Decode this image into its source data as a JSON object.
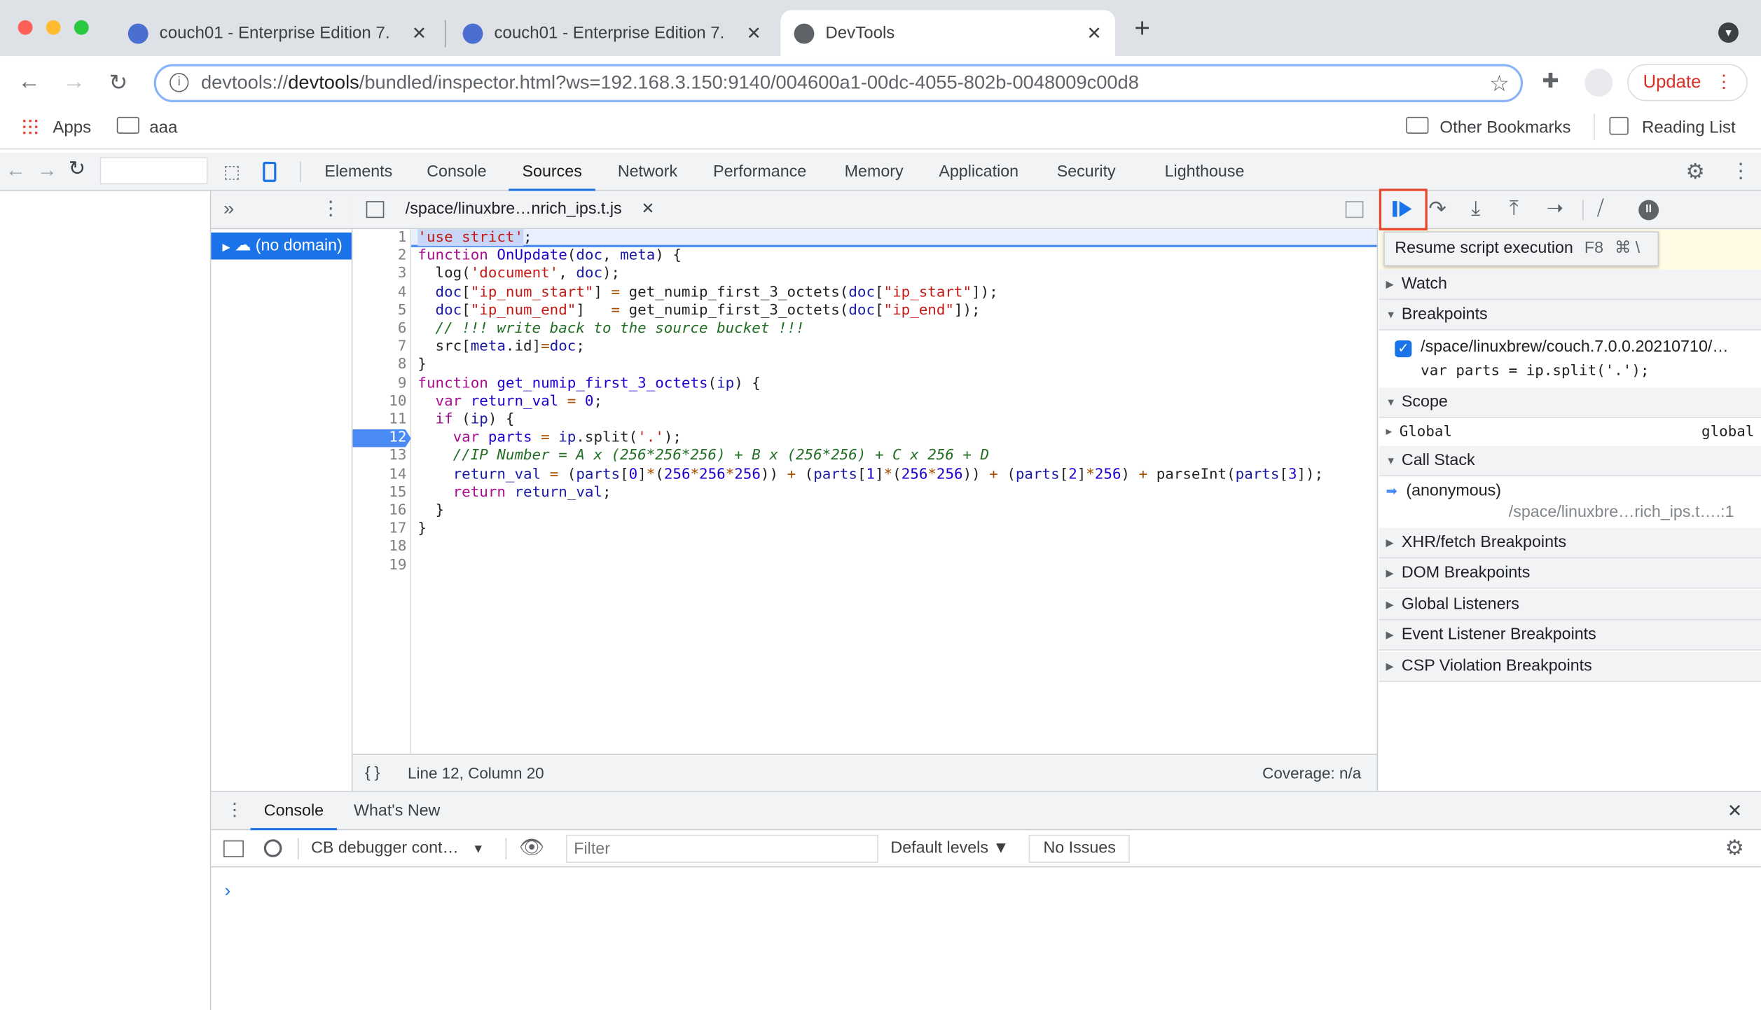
{
  "browser": {
    "tabs": [
      {
        "title": "couch01 - Enterprise Edition 7."
      },
      {
        "title": "couch01 - Enterprise Edition 7."
      },
      {
        "title": "DevTools"
      }
    ],
    "new_tab": "+",
    "url_prefix": "devtools://",
    "url_host": "devtools",
    "url_rest": "/bundled/inspector.html?ws=192.168.3.150:9140/004600a1-00dc-4055-802b-0048009c00d8",
    "update_label": "Update",
    "bookmarks": {
      "apps": "Apps",
      "folder": "aaa",
      "other": "Other Bookmarks",
      "reading_list": "Reading List"
    }
  },
  "devtools": {
    "tabs": [
      "Elements",
      "Console",
      "Sources",
      "Network",
      "Performance",
      "Memory",
      "Application",
      "Security",
      "Lighthouse"
    ],
    "active_tab": "Sources",
    "navigator": {
      "more": "»",
      "item": "(no domain)"
    },
    "file_tab": "/space/linuxbre…nrich_ips.t.js",
    "code": [
      [
        [
          "'use strict'",
          "str"
        ],
        [
          ";",
          "p"
        ]
      ],
      [
        [
          "function ",
          "kw"
        ],
        [
          "OnUpdate",
          "def"
        ],
        [
          "(",
          "p"
        ],
        [
          "doc",
          "var"
        ],
        [
          ", ",
          "p"
        ],
        [
          "meta",
          "var"
        ],
        [
          ") {",
          "p"
        ]
      ],
      [
        [
          "  log(",
          "p"
        ],
        [
          "'document'",
          "str"
        ],
        [
          ", ",
          "p"
        ],
        [
          "doc",
          "var"
        ],
        [
          ");",
          "p"
        ]
      ],
      [
        [
          "  ",
          "p"
        ],
        [
          "doc",
          "var"
        ],
        [
          "[",
          "p"
        ],
        [
          "\"ip_num_start\"",
          "str"
        ],
        [
          "] ",
          "p"
        ],
        [
          "=",
          "op"
        ],
        [
          " get_numip_first_3_octets(",
          "p"
        ],
        [
          "doc",
          "var"
        ],
        [
          "[",
          "p"
        ],
        [
          "\"ip_start\"",
          "str"
        ],
        [
          "]);",
          "p"
        ]
      ],
      [
        [
          "  ",
          "p"
        ],
        [
          "doc",
          "var"
        ],
        [
          "[",
          "p"
        ],
        [
          "\"ip_num_end\"",
          "str"
        ],
        [
          "]   ",
          "p"
        ],
        [
          "=",
          "op"
        ],
        [
          " get_numip_first_3_octets(",
          "p"
        ],
        [
          "doc",
          "var"
        ],
        [
          "[",
          "p"
        ],
        [
          "\"ip_end\"",
          "str"
        ],
        [
          "]);",
          "p"
        ]
      ],
      [
        [
          "  // !!! write back to the source bucket !!!",
          "com"
        ]
      ],
      [
        [
          "  src[",
          "p"
        ],
        [
          "meta",
          "var"
        ],
        [
          ".id]",
          "p"
        ],
        [
          "=",
          "op"
        ],
        [
          "doc",
          "var"
        ],
        [
          ";",
          "p"
        ]
      ],
      [
        [
          "}",
          "p"
        ]
      ],
      [
        [
          "function ",
          "kw"
        ],
        [
          "get_numip_first_3_octets",
          "def"
        ],
        [
          "(",
          "p"
        ],
        [
          "ip",
          "var"
        ],
        [
          ") {",
          "p"
        ]
      ],
      [
        [
          "  ",
          "p"
        ],
        [
          "var ",
          "kw"
        ],
        [
          "return_val",
          "def"
        ],
        [
          " ",
          "p"
        ],
        [
          "=",
          "op"
        ],
        [
          " ",
          "p"
        ],
        [
          "0",
          "num"
        ],
        [
          ";",
          "p"
        ]
      ],
      [
        [
          "  ",
          "p"
        ],
        [
          "if ",
          "kw"
        ],
        [
          "(",
          "p"
        ],
        [
          "ip",
          "var"
        ],
        [
          ") {",
          "p"
        ]
      ],
      [
        [
          "    ",
          "p"
        ],
        [
          "var ",
          "kw"
        ],
        [
          "parts",
          "def"
        ],
        [
          " ",
          "p"
        ],
        [
          "=",
          "op"
        ],
        [
          " ",
          "p"
        ],
        [
          "ip",
          "var"
        ],
        [
          ".split(",
          "p"
        ],
        [
          "'.'",
          "str"
        ],
        [
          ");",
          "p"
        ]
      ],
      [
        [
          "    //IP Number = A x (256*256*256) + B x (256*256) + C x 256 + D",
          "com"
        ]
      ],
      [
        [
          "    ",
          "p"
        ],
        [
          "return_val",
          "var"
        ],
        [
          " ",
          "p"
        ],
        [
          "=",
          "op"
        ],
        [
          " (",
          "p"
        ],
        [
          "parts",
          "var"
        ],
        [
          "[",
          "p"
        ],
        [
          "0",
          "num"
        ],
        [
          "]",
          "p"
        ],
        [
          "*",
          "op"
        ],
        [
          "(",
          "p"
        ],
        [
          "256",
          "num"
        ],
        [
          "*",
          "op"
        ],
        [
          "256",
          "num"
        ],
        [
          "*",
          "op"
        ],
        [
          "256",
          "num"
        ],
        [
          ")) ",
          "p"
        ],
        [
          "+",
          "op"
        ],
        [
          " (",
          "p"
        ],
        [
          "parts",
          "var"
        ],
        [
          "[",
          "p"
        ],
        [
          "1",
          "num"
        ],
        [
          "]",
          "p"
        ],
        [
          "*",
          "op"
        ],
        [
          "(",
          "p"
        ],
        [
          "256",
          "num"
        ],
        [
          "*",
          "op"
        ],
        [
          "256",
          "num"
        ],
        [
          ")) ",
          "p"
        ],
        [
          "+",
          "op"
        ],
        [
          " (",
          "p"
        ],
        [
          "parts",
          "var"
        ],
        [
          "[",
          "p"
        ],
        [
          "2",
          "num"
        ],
        [
          "]",
          "p"
        ],
        [
          "*",
          "op"
        ],
        [
          "256",
          "num"
        ],
        [
          ") ",
          "p"
        ],
        [
          "+",
          "op"
        ],
        [
          " parseInt(",
          "p"
        ],
        [
          "parts",
          "var"
        ],
        [
          "[",
          "p"
        ],
        [
          "3",
          "num"
        ],
        [
          "]);",
          "p"
        ]
      ],
      [
        [
          "    ",
          "p"
        ],
        [
          "return ",
          "kw"
        ],
        [
          "return_val",
          "var"
        ],
        [
          ";",
          "p"
        ]
      ],
      [
        [
          "  }",
          "p"
        ]
      ],
      [
        [
          "}",
          "p"
        ]
      ],
      [
        [
          "",
          "p"
        ]
      ],
      [
        [
          "",
          "p"
        ]
      ]
    ],
    "breakpoint_line": 12,
    "status": {
      "format": "{ }",
      "position": "Line 12, Column 20",
      "coverage": "Coverage: n/a"
    },
    "debugger": {
      "tooltip": {
        "text": "Resume script execution",
        "shortcut1": "F8",
        "shortcut2": "⌘ \\"
      },
      "sections": {
        "watch": "Watch",
        "breakpoints": "Breakpoints",
        "scope": "Scope",
        "call_stack": "Call Stack",
        "xhr": "XHR/fetch Breakpoints",
        "dom": "DOM Breakpoints",
        "global_listeners": "Global Listeners",
        "event_listener": "Event Listener Breakpoints",
        "csp": "CSP Violation Breakpoints"
      },
      "breakpoint_item": {
        "file": "/space/linuxbrew/couch.7.0.0.20210710/…",
        "code": "var parts = ip.split('.');",
        "checked": true
      },
      "scope_item": {
        "name": "Global",
        "value": "global"
      },
      "call_frame": {
        "name": "(anonymous)",
        "location": "/space/linuxbre…rich_ips.t….:1"
      }
    },
    "drawer": {
      "tabs": [
        "Console",
        "What's New"
      ],
      "context": "CB debugger cont…",
      "filter_placeholder": "Filter",
      "levels": "Default levels ▼",
      "issues": "No Issues",
      "prompt": "›"
    }
  }
}
